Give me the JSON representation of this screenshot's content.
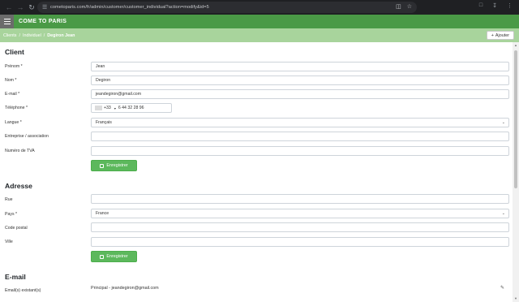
{
  "browser": {
    "url": "cometoparis.com/fr/admin/customer/customer_individual?action=modify&id=5",
    "back_icon": "arrow-left-icon",
    "forward_icon": "arrow-right-icon",
    "reload_icon": "reload-icon"
  },
  "app": {
    "brand": "COME TO PARIS"
  },
  "breadcrumb": {
    "items": [
      "Clients",
      "Individuel"
    ],
    "current": "Degiron Jean",
    "separator": "/"
  },
  "header": {
    "add_label": "Ajouter",
    "add_icon": "plus-icon"
  },
  "client": {
    "title": "Client",
    "fields": {
      "prenom": {
        "label": "Prénom *",
        "value": "Jean"
      },
      "nom": {
        "label": "Nom *",
        "value": "Degiron"
      },
      "email": {
        "label": "E-mail *",
        "value": "jeandegiron@gmail.com"
      },
      "telephone": {
        "label": "Téléphone *",
        "country_code": "+33",
        "value": "6 44 32 28 96"
      },
      "langue": {
        "label": "Langue *",
        "value": "Français"
      },
      "entreprise": {
        "label": "Entreprise / association",
        "value": ""
      },
      "tva": {
        "label": "Numéro de TVA",
        "value": ""
      }
    },
    "save_label": "Enregistrer"
  },
  "adresse": {
    "title": "Adresse",
    "fields": {
      "rue": {
        "label": "Rue",
        "value": ""
      },
      "pays": {
        "label": "Pays *",
        "value": "France"
      },
      "code_postal": {
        "label": "Code postal",
        "value": ""
      },
      "ville": {
        "label": "Ville",
        "value": ""
      }
    },
    "save_label": "Enregistrer"
  },
  "emails": {
    "title": "E-mail",
    "existing_label": "Email(s) existant(s)",
    "existing_value": "Principal - jeandegiron@gmail.com",
    "edit_icon": "pencil-icon"
  },
  "colors": {
    "appbar": "#4a9a46",
    "breadcrumb_bar": "#a8d49c",
    "save_button": "#5cb85c"
  }
}
